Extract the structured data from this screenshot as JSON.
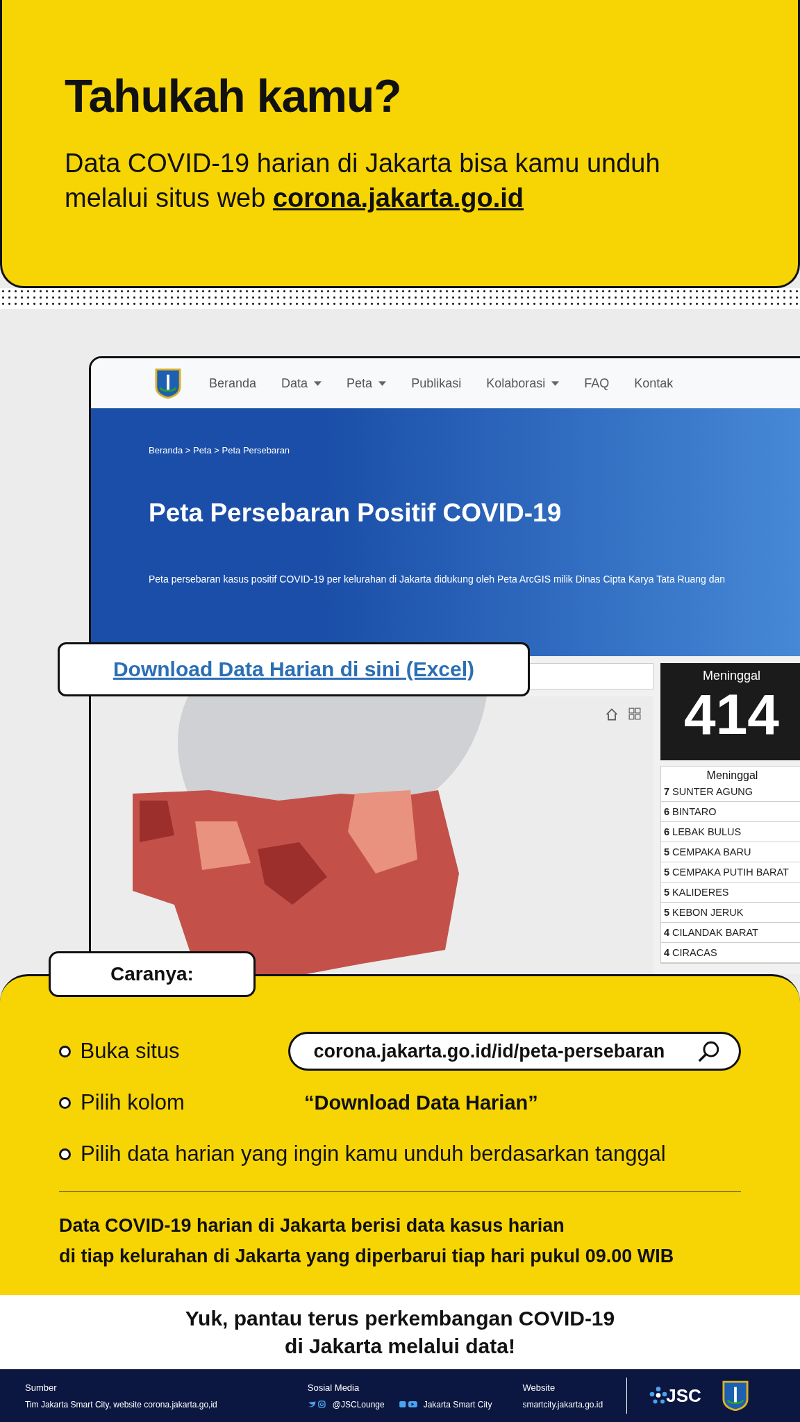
{
  "intro": {
    "title": "Tahukah kamu?",
    "text": "Data COVID-19 harian di Jakarta bisa kamu unduh melalui situs web",
    "link": "corona.jakarta.go.id"
  },
  "browser": {
    "nav": [
      {
        "label": "Beranda",
        "dropdown": false
      },
      {
        "label": "Data",
        "dropdown": true
      },
      {
        "label": "Peta",
        "dropdown": true
      },
      {
        "label": "Publikasi",
        "dropdown": false
      },
      {
        "label": "Kolaborasi",
        "dropdown": true
      },
      {
        "label": "FAQ",
        "dropdown": false
      },
      {
        "label": "Kontak",
        "dropdown": false
      }
    ],
    "breadcrumb": "Beranda > Peta > Peta Persebaran",
    "title": "Peta Persebaran Positif COVID-19",
    "description": "Peta persebaran kasus positif COVID-19 per kelurahan di Jakarta didukung oleh Peta ArcGIS milik Dinas Cipta Karya Tata Ruang dan",
    "stat": {
      "label": "Meninggal",
      "value": "414"
    },
    "list": {
      "header": "Meninggal",
      "rows": [
        {
          "count": "7",
          "name": "SUNTER AGUNG"
        },
        {
          "count": "6",
          "name": "BINTARO"
        },
        {
          "count": "6",
          "name": "LEBAK BULUS"
        },
        {
          "count": "5",
          "name": "CEMPAKA BARU"
        },
        {
          "count": "5",
          "name": "CEMPAKA PUTIH BARAT"
        },
        {
          "count": "5",
          "name": "KALIDERES"
        },
        {
          "count": "5",
          "name": "KEBON JERUK"
        },
        {
          "count": "4",
          "name": "CILANDAK BARAT"
        },
        {
          "count": "4",
          "name": "CIRACAS"
        }
      ]
    }
  },
  "callout": "Download Data Harian di sini (Excel)",
  "steps": {
    "label": "Caranya:",
    "items": [
      {
        "kind": "url",
        "text": "Buka situs",
        "value": "corona.jakarta.go.id/id/peta-persebaran"
      },
      {
        "kind": "quote",
        "text": "Pilih kolom",
        "value": "“Download Data Harian”"
      },
      {
        "kind": "plain",
        "text": "Pilih data harian yang ingin kamu unduh berdasarkan tanggal"
      }
    ],
    "note": [
      "Data COVID-19 harian di Jakarta berisi data kasus harian",
      "di tiap kelurahan di Jakarta yang diperbarui **tiap hari pukul 09.00 WIB**"
    ]
  },
  "closing": [
    "Yuk, pantau terus perkembangan COVID-19",
    "di Jakarta melalui data!"
  ],
  "footer": {
    "source_label": "Sumber",
    "source": "Tim Jakarta Smart City, website corona.jakarta.go,id",
    "social_label": "Sosial Media",
    "social": [
      {
        "kind": "twitter-instagram",
        "handle": "@JSCLounge"
      },
      {
        "kind": "facebook-youtube",
        "handle": "Jakarta Smart City"
      }
    ],
    "website_label": "Website",
    "website": "smartcity.jakarta.go.id",
    "brand": "JSC"
  }
}
